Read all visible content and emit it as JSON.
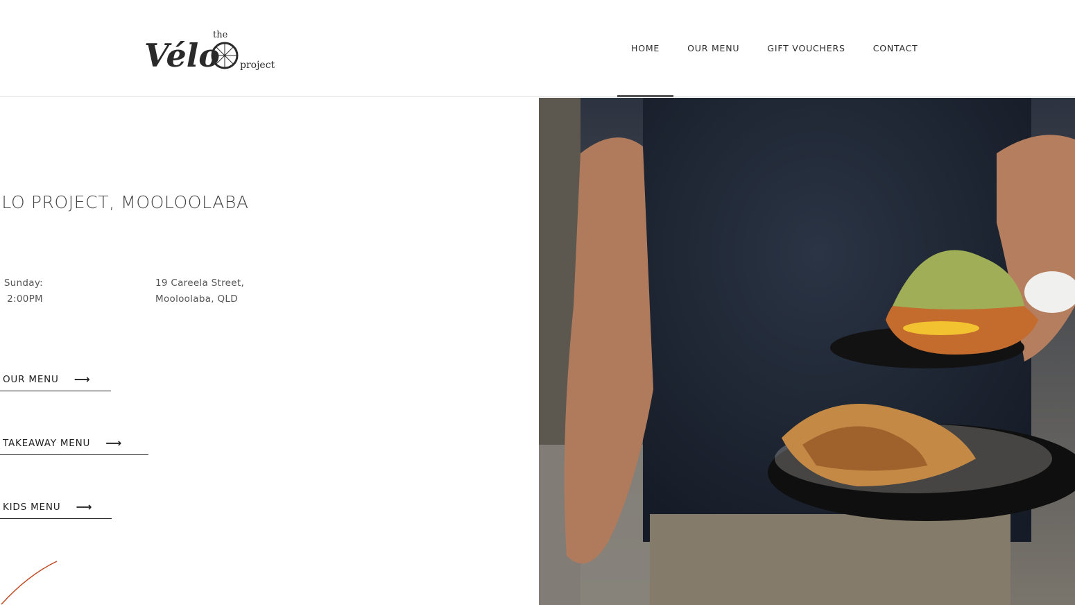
{
  "brand": {
    "logo_word": "Vélo",
    "logo_the": "the",
    "logo_project": "project"
  },
  "nav": {
    "items": [
      {
        "label": "HOME",
        "active": true
      },
      {
        "label": "OUR MENU",
        "active": false
      },
      {
        "label": "GIFT VOUCHERS",
        "active": false
      },
      {
        "label": "CONTACT",
        "active": false
      }
    ]
  },
  "main": {
    "title": "ELO PROJECT, MOOLOOLABA",
    "hours_line1": "Sunday:",
    "hours_line2": "2:00PM",
    "address_line1": "19 Careela Street,",
    "address_line2": "Mooloolaba, QLD",
    "buttons": [
      {
        "label": "OUR MENU",
        "icon": "arrow-right-icon"
      },
      {
        "label": "TAKEAWAY MENU",
        "icon": "arrow-right-icon"
      },
      {
        "label": "KIDS MENU",
        "icon": "arrow-right-icon"
      }
    ]
  },
  "colors": {
    "accent_stroke": "#c2461e",
    "nav_active_bar": "#555555"
  }
}
